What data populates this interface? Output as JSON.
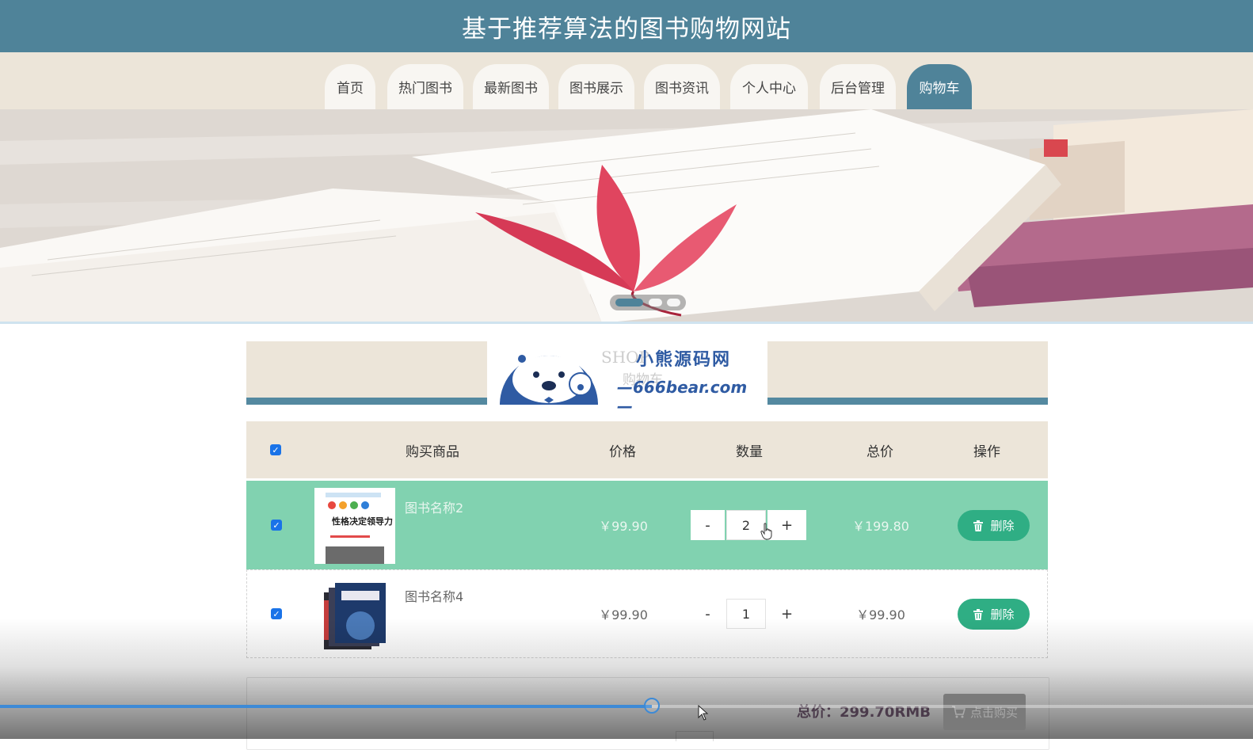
{
  "header": {
    "title": "基于推荐算法的图书购物网站"
  },
  "nav": {
    "items": [
      {
        "label": "首页"
      },
      {
        "label": "热门图书"
      },
      {
        "label": "最新图书"
      },
      {
        "label": "图书展示"
      },
      {
        "label": "图书资讯"
      },
      {
        "label": "个人中心"
      },
      {
        "label": "后台管理"
      },
      {
        "label": "购物车"
      }
    ],
    "active_index": 7
  },
  "banner": {
    "slide_count": 3,
    "active_slide": 0
  },
  "section": {
    "title_en": "SHOP",
    "title_cn": "购物车"
  },
  "watermark": {
    "name": "小熊源码网",
    "url": "—666bear.com—"
  },
  "cart": {
    "headers": {
      "product": "购买商品",
      "price": "价格",
      "quantity": "数量",
      "total": "总价",
      "action": "操作"
    },
    "all_checked": true,
    "items": [
      {
        "name": "图书名称2",
        "price": "￥99.90",
        "quantity": "2",
        "subtotal": "￥199.80",
        "checked": true,
        "selected_row": true,
        "cover_title": "性格决定领导力"
      },
      {
        "name": "图书名称4",
        "price": "￥99.90",
        "quantity": "1",
        "subtotal": "￥99.90",
        "checked": true,
        "selected_row": false,
        "cover_title": ""
      }
    ],
    "minus_label": "-",
    "plus_label": "+",
    "delete_label": "删除"
  },
  "summary": {
    "total_label": "总价：299.70RMB",
    "buy_label": "点击购买"
  },
  "video": {
    "progress": 0.52
  },
  "colors": {
    "primary": "#4f8399",
    "nav_bg": "#ece5d9",
    "selected_row": "#81d2b0",
    "delete_button": "#2fae84",
    "progress": "#3d8ad6"
  },
  "icons": {
    "delete": "trash-icon",
    "buy": "cart-icon",
    "checkbox": "check-icon"
  }
}
